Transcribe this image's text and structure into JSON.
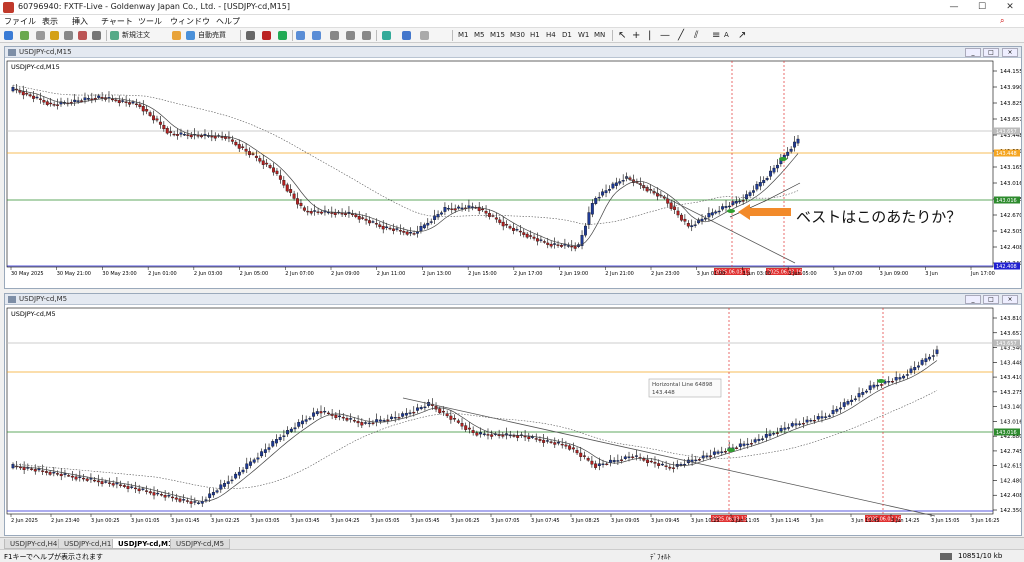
{
  "window": {
    "title": "60796940: FXTF-Live - Goldenway Japan Co., Ltd. - [USDJPY-cd,M15]",
    "min_label": "—",
    "max_label": "☐",
    "close_label": "✕"
  },
  "menu": [
    "ファイル",
    "表示",
    "挿入",
    "チャート",
    "ツール",
    "ウィンドウ",
    "ヘルプ"
  ],
  "toolbar": {
    "new_order": "新規注文",
    "auto_trade": "自動売買",
    "timeframes": [
      "M1",
      "M5",
      "M15",
      "M30",
      "H1",
      "H4",
      "D1",
      "W1",
      "MN"
    ]
  },
  "top_chart": {
    "window_caption": "USDJPY-cd,M15",
    "label": "USDJPY-cd,M15",
    "price_labels": [
      "144.155",
      "143.990",
      "143.825",
      "143.657",
      "143.448",
      "143.330",
      "143.165",
      "143.016",
      "142.835",
      "142.670",
      "142.505",
      "142.408",
      "142.340"
    ],
    "current_price": "143.657",
    "orange_line_price": "143.448",
    "green_line_price": "143.016",
    "blue_line_price": "142.408",
    "time_labels": [
      "30 May 2025",
      "30 May 21:00",
      "30 May 23:00",
      "2 Jun 01:00",
      "2 Jun 03:00",
      "2 Jun 05:00",
      "2 Jun 07:00",
      "2 Jun 09:00",
      "2 Jun 11:00",
      "2 Jun 13:00",
      "2 Jun 15:00",
      "2 Jun 17:00",
      "2 Jun 19:00",
      "2 Jun 21:00",
      "2 Jun 23:00",
      "3 Jun 01:00",
      "3 Jun 03:00",
      "3 Jun 05:00",
      "3 Jun 07:00",
      "3 Jun 09:00",
      "3 Jun",
      "Jun 17:00"
    ],
    "vline_labels": [
      "2025.06.03 13:00",
      "2025.06.03 16:00"
    ],
    "annotation": "ベストはこのあたりか？"
  },
  "bottom_chart": {
    "window_caption": "USDJPY-cd,M5",
    "label": "USDJPY-cd,M5",
    "price_labels": [
      "143.810",
      "143.657",
      "143.540",
      "143.448",
      "143.410",
      "143.275",
      "143.140",
      "143.016",
      "142.880",
      "142.745",
      "142.615",
      "142.480",
      "142.408",
      "142.350"
    ],
    "current_price": "143.657",
    "tooltip_title": "Horizontal Line 64898",
    "tooltip_value": "143.448",
    "time_labels": [
      "2 Jun 2025",
      "2 Jun 23:40",
      "3 Jun 00:25",
      "3 Jun 01:05",
      "3 Jun 01:45",
      "3 Jun 02:25",
      "3 Jun 03:05",
      "3 Jun 03:45",
      "3 Jun 04:25",
      "3 Jun 05:05",
      "3 Jun 05:45",
      "3 Jun 06:25",
      "3 Jun 07:05",
      "3 Jun 07:45",
      "3 Jun 08:25",
      "3 Jun 09:05",
      "3 Jun 09:45",
      "3 Jun 10:25",
      "3 Jun 11:05",
      "3 Jun 11:45",
      "3 Jun",
      "3 Jun 13:45",
      "3 Jun 14:25",
      "3 Jun 15:05",
      "3 Jun 16:25"
    ],
    "vline_labels": [
      "2025.06.03 13:00",
      "2025.06.03 16:00"
    ]
  },
  "tabs": [
    "USDJPY-cd,H4",
    "USDJPY-cd,H1",
    "USDJPY-cd,M15",
    "USDJPY-cd,M5"
  ],
  "active_tab": "USDJPY-cd,M15",
  "status": {
    "help": "F1キーでヘルプが表示されます",
    "profile": "ﾃﾞﾌｫﾙﾄ",
    "traffic": "10851/10 kb"
  },
  "colors": {
    "bull": "#1f3a93",
    "bear": "#b22222",
    "orange_line": "#f5a623",
    "green_line": "#2e8b2e",
    "blue_line": "#2020d0",
    "vline": "#e03030",
    "arrow": "#f28a2a"
  }
}
